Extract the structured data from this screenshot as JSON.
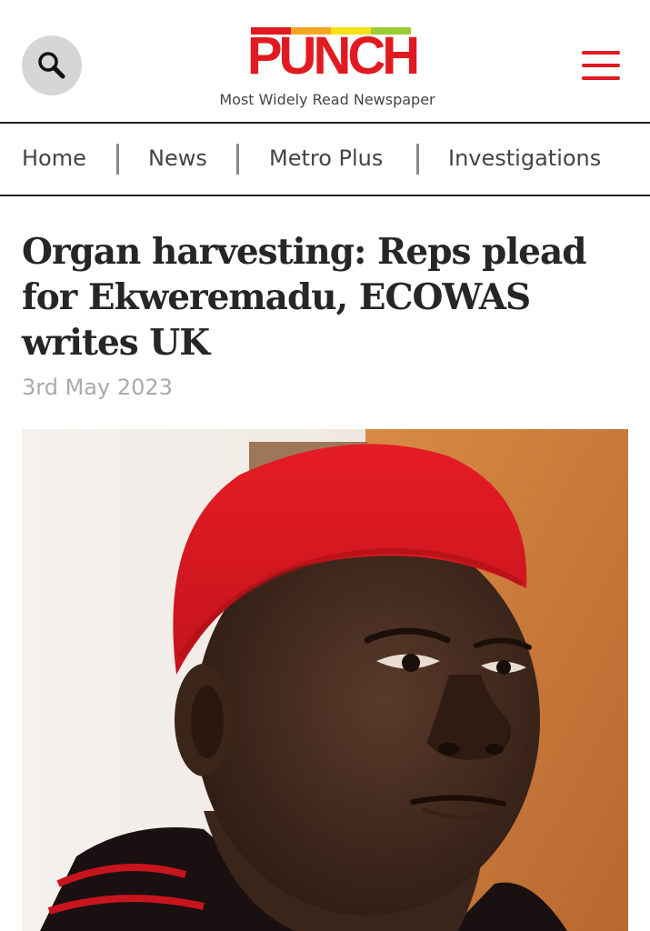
{
  "header": {
    "logo_text": "PUNCH",
    "tagline": "Most Widely Read Newspaper",
    "search_icon": "search-icon",
    "menu_icon": "hamburger-menu-icon"
  },
  "nav": {
    "items": [
      {
        "label": "Home"
      },
      {
        "label": "News"
      },
      {
        "label": "Metro Plus"
      },
      {
        "label": "Investigations"
      }
    ]
  },
  "article": {
    "headline": "Organ harvesting: Reps plead for Ekweremadu, ECOWAS writes UK",
    "date": "3rd May 2023"
  },
  "colors": {
    "brand_red": "#e11a22",
    "text_dark": "#262626",
    "date_gray": "#aaaaaa",
    "search_bg": "#d6d6d6"
  }
}
